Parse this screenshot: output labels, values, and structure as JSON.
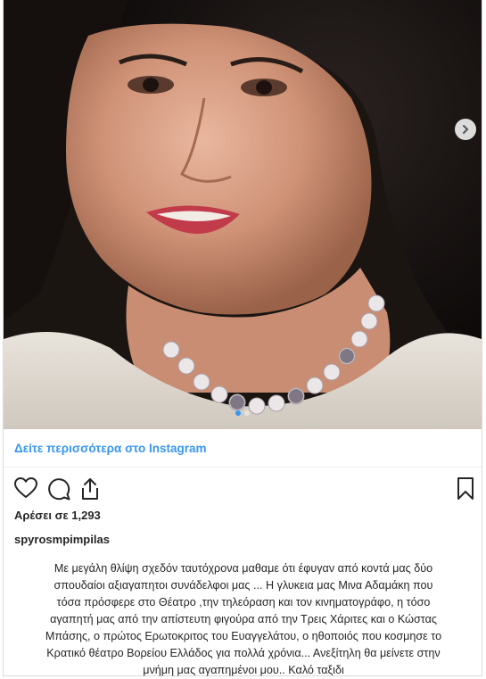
{
  "post": {
    "image_alt": "Portrait photo of a smiling woman with dark curly hair and a pearl necklace",
    "carousel": {
      "total": 2,
      "active": 1,
      "next_icon": "chevron-right-icon"
    },
    "more_link": "Δείτε περισσότερα στο Instagram",
    "likes": "Αρέσει σε 1,293",
    "username": "spyrosmpimpilas",
    "caption_lines": [
      "Με μεγάλη θλίψη σχεδόν ταυτόχρονα μαθαμε ότι έφυγαν από κοντά μας δύο",
      "σπουδαίοι αξιαγαπητοι συνάδελφοι μας ... Η γλυκεια μας Μινα Αδαμάκη που",
      "τόσα πρόσφερε στο Θέατρο ,την τηλεόραση και τον κινηματογράφο, η τόσο",
      "αγαπητή μας από την απίστευτη φιγούρα από την Τρεις Χάριτες και ο Κώστας",
      "Μπάσης, ο πρώτος Ερωτοκριτος του Ευαγγελάτου, ο ηθοποιός που κοσμησε το",
      "Κρατικό θέατρο Βορείου Ελλάδος για πολλά χρόνια... Ανεξίτηλη θα μείνετε στην",
      "μνήμη μας αγαπημένοι μου.. Καλό ταξιδι"
    ]
  },
  "icons": {
    "like": "heart-icon",
    "comment": "comment-icon",
    "share": "share-icon",
    "save": "bookmark-icon"
  }
}
